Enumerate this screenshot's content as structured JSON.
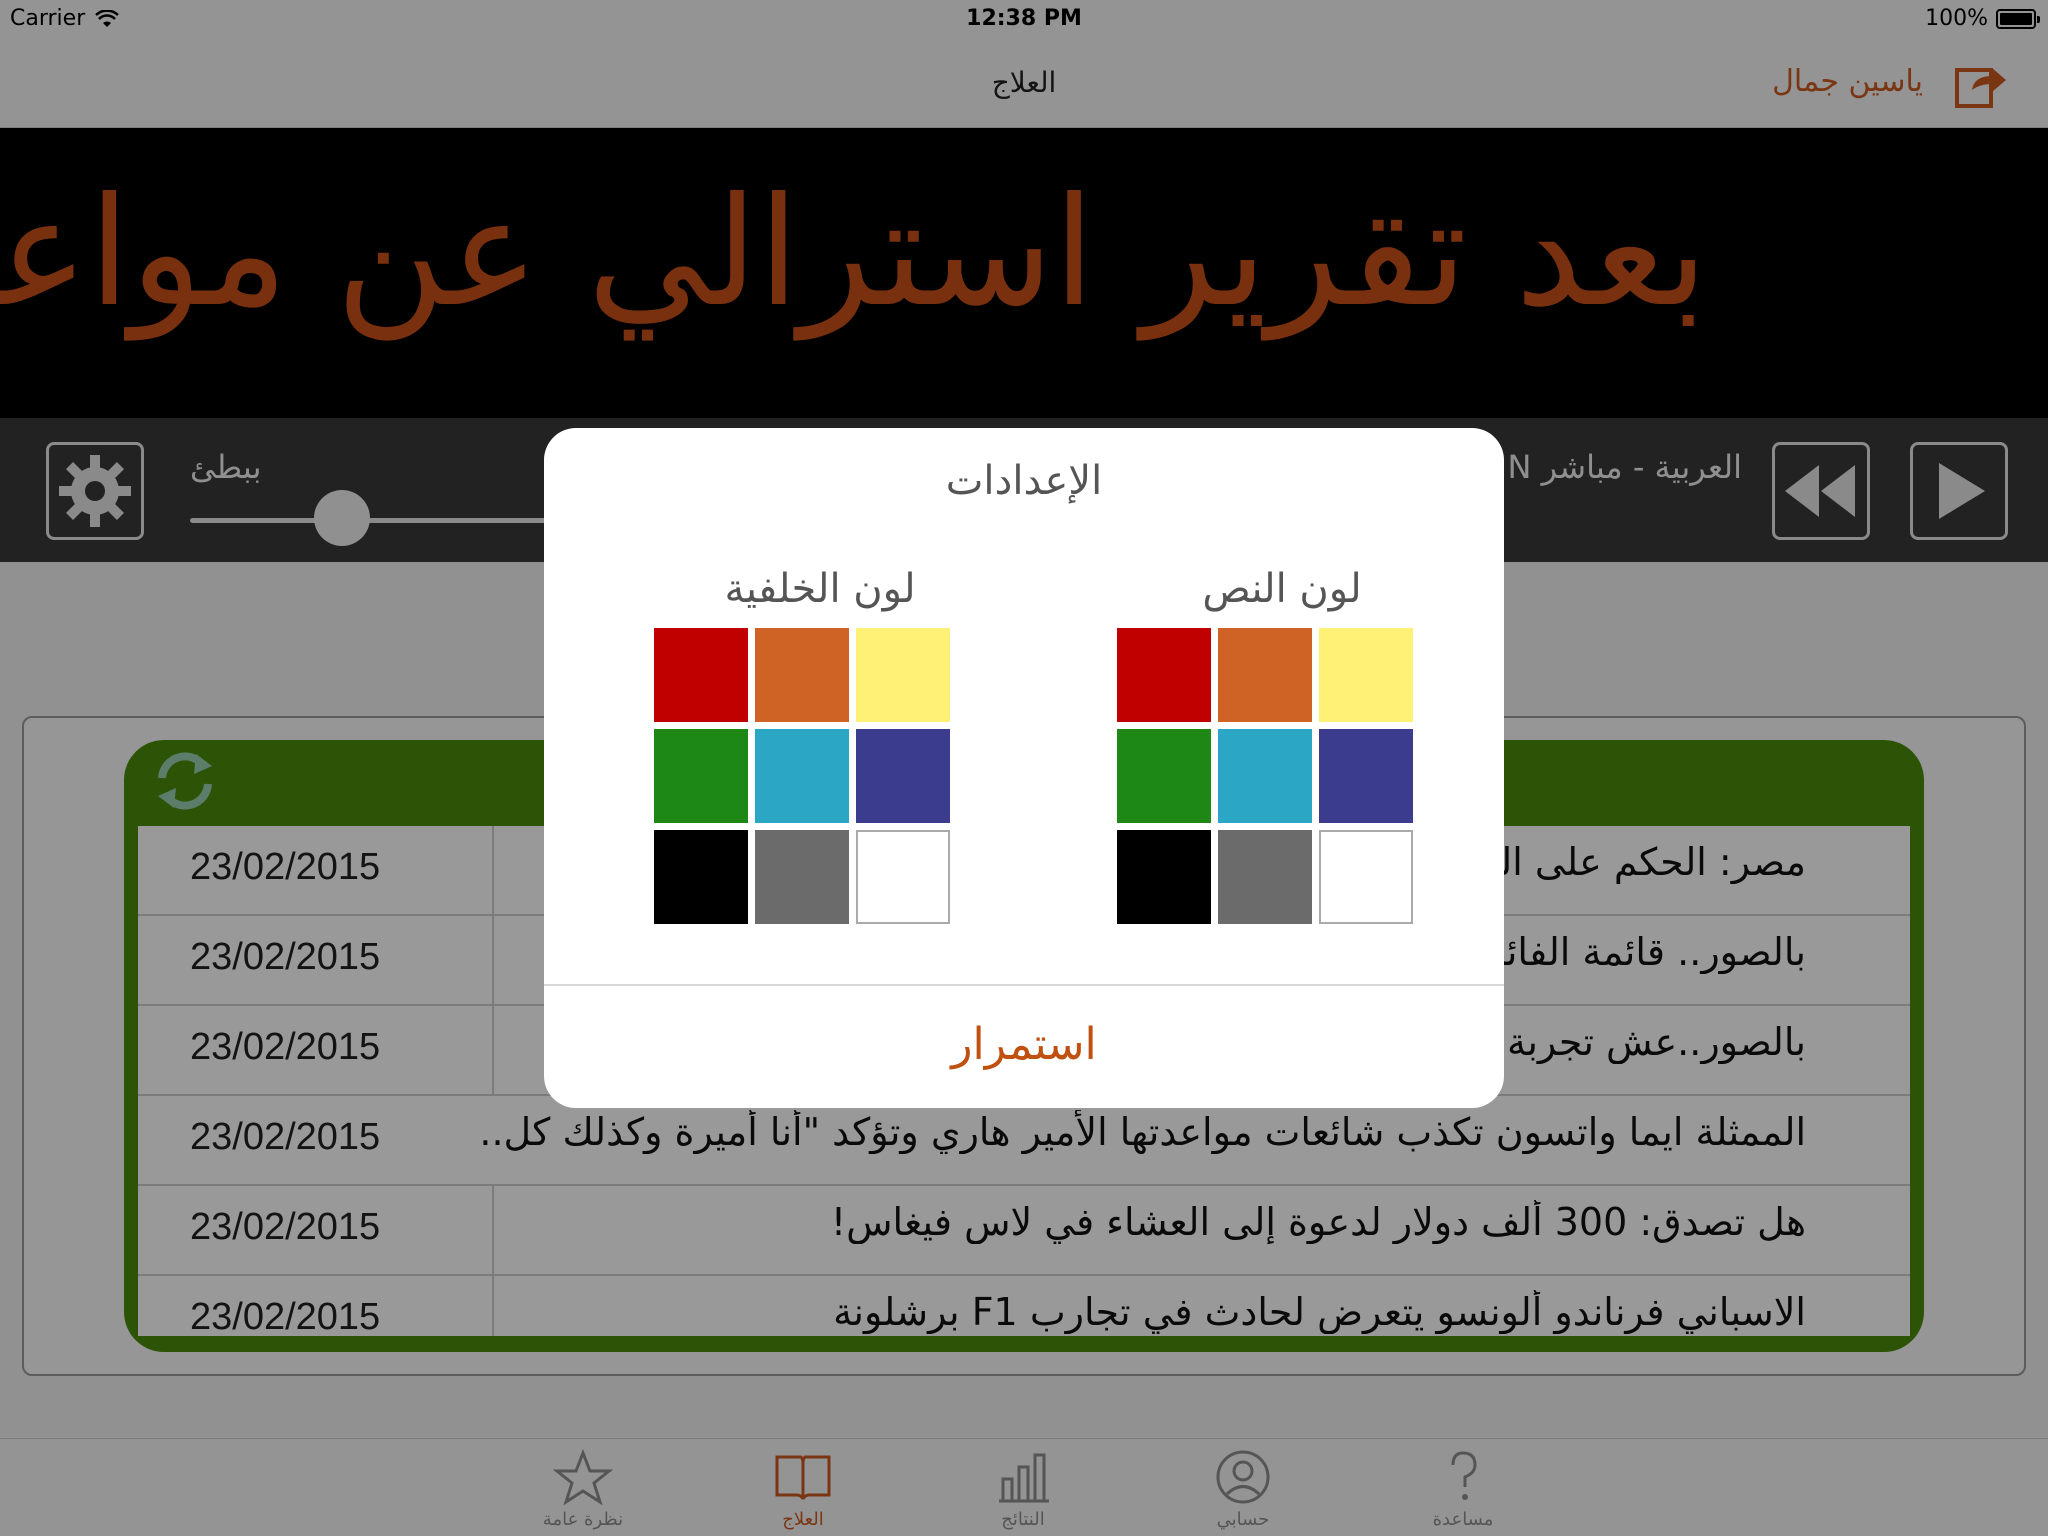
{
  "status_bar": {
    "carrier": "Carrier",
    "time": "12:38 PM",
    "battery": "100%"
  },
  "nav": {
    "title": "العلاج",
    "user_name": "ياسين جمال",
    "icon": "logout-icon"
  },
  "ticker": {
    "text": "بعد تقرير استرالي عن مواعدة سر"
  },
  "controls": {
    "speed_label": "ببطئ",
    "channel_label": "العربية - مباشر N",
    "speed_level": 0.4
  },
  "news": [
    {
      "date": "23/02/2015",
      "headline": "مصر: الحكم على النشطاء.."
    },
    {
      "date": "23/02/2015",
      "headline": "بالصور.. قائمة الفائزين"
    },
    {
      "date": "23/02/2015",
      "headline": "بالصور..عش تجربة"
    },
    {
      "date": "23/02/2015",
      "headline": "الممثلة ايما واتسون تكذب شائعات مواعدتها الأمير هاري وتؤكد \"أنا أميرة وكذلك كل.."
    },
    {
      "date": "23/02/2015",
      "headline": "هل تصدق: 300 ألف دولار لدعوة إلى العشاء في لاس فيغاس!"
    },
    {
      "date": "23/02/2015",
      "headline": "الاسباني فرناندو ألونسو يتعرض لحادث في تجارب F1 برشلونة"
    }
  ],
  "tabs": [
    {
      "label": "نظرة عامة",
      "icon": "star-icon",
      "active": false
    },
    {
      "label": "العلاج",
      "icon": "book-icon",
      "active": true
    },
    {
      "label": "النتائج",
      "icon": "bar-chart-icon",
      "active": false
    },
    {
      "label": "حسابي",
      "icon": "person-icon",
      "active": false
    },
    {
      "label": "مساعدة",
      "icon": "question-icon",
      "active": false
    }
  ],
  "dialog": {
    "title": "الإعدادات",
    "background_color_title": "لون الخلفية",
    "text_color_title": "لون النص",
    "continue_label": "استمرار",
    "palette": [
      "#c00000",
      "#cf6225",
      "#fff176",
      "#1e8816",
      "#2ca6c5",
      "#3b3c8e",
      "#000000",
      "#6b6b6b",
      "#ffffff"
    ]
  },
  "colors": {
    "accent": "#cc5a20",
    "ticker_text": "#c8501a",
    "ticker_bg": "#000000",
    "frame_green": "#4a8a0a"
  }
}
